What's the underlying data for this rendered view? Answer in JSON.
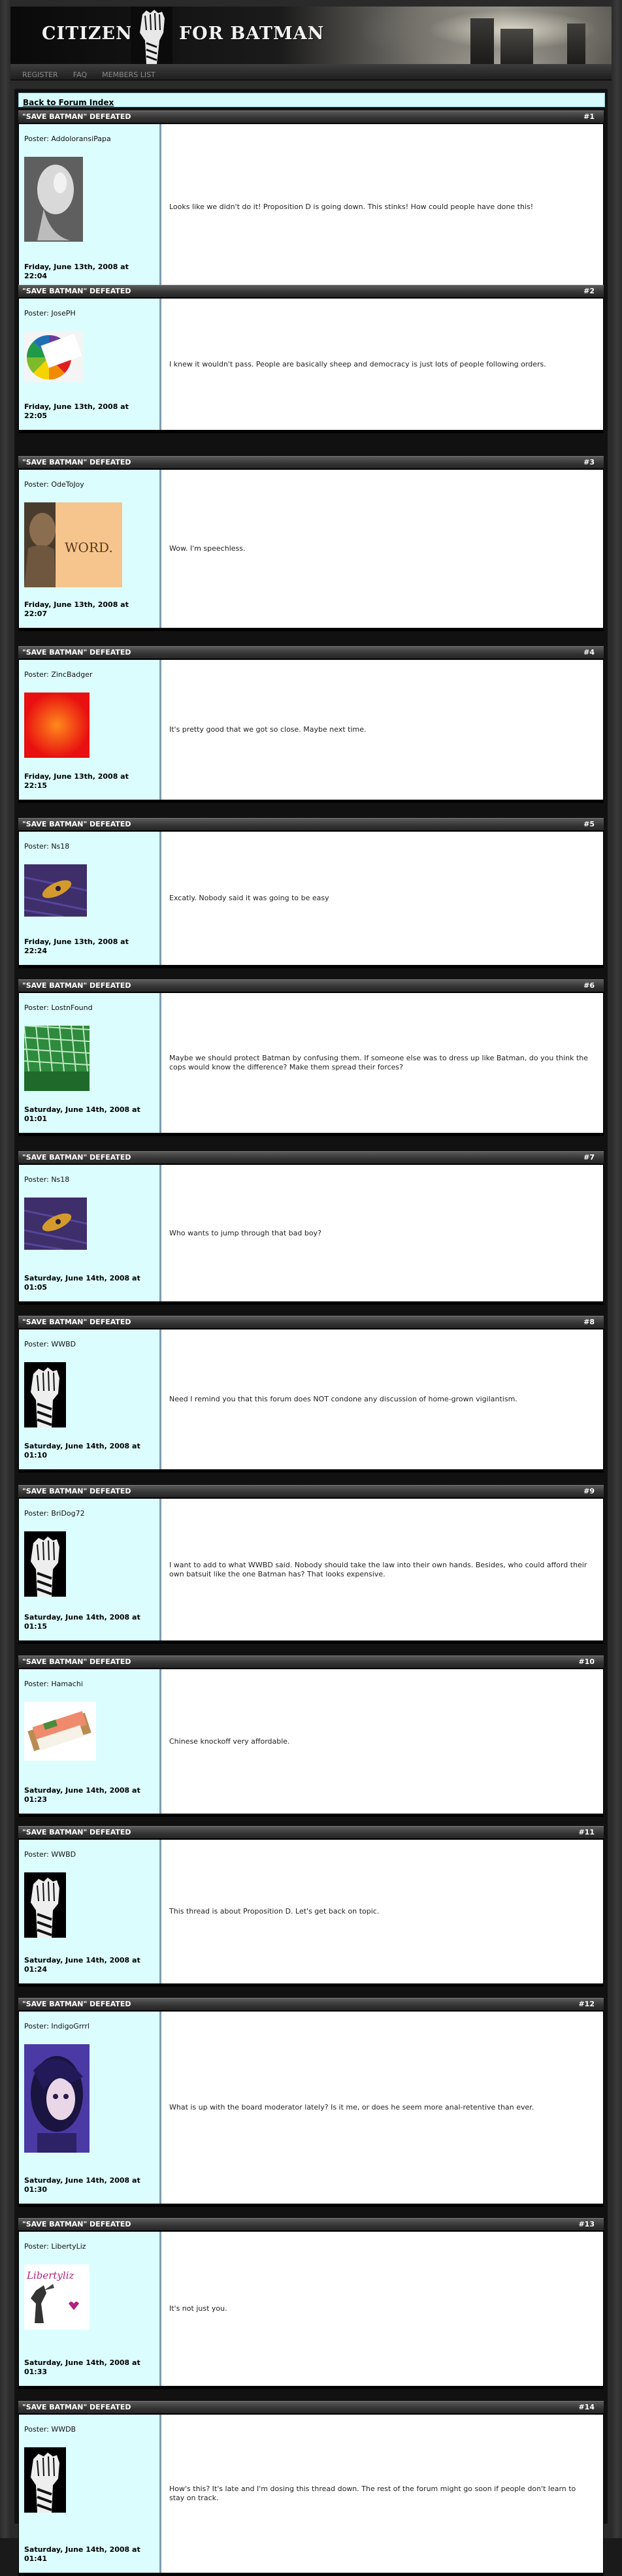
{
  "site": {
    "title_left": "CITIZENS",
    "title_right": "FOR BATMAN"
  },
  "nav": {
    "items": [
      "REGISTER",
      "FAQ",
      "MEMBERS LIST"
    ]
  },
  "back_link": "Back to Forum Index",
  "thread_title": "\"SAVE BATMAN\" DEFEATED",
  "poster_prefix": "Poster:",
  "posts": [
    {
      "num": "#1",
      "poster": "AddoloransiPapa",
      "date": "Friday, June 13th, 2008 at 22:04",
      "avatar": "hand-photo",
      "text": "Looks like we didn't do it! Proposition D is going down. This stinks! How could people have done this!"
    },
    {
      "num": "#2",
      "poster": "JosePH",
      "date": "Friday, June 13th, 2008 at 22:05",
      "avatar": "color-wheel",
      "text": "I knew it wouldn't pass. People are basically sheep and democracy is just lots of people following orders."
    },
    {
      "num": "#3",
      "poster": "OdeToJoy",
      "date": "Friday, June 13th, 2008 at 22:07",
      "avatar": "word-bust",
      "avatar_text": "WORD.",
      "text": "Wow. I'm speechless."
    },
    {
      "num": "#4",
      "poster": "ZincBadger",
      "date": "Friday, June 13th, 2008 at 22:15",
      "avatar": "red-orange",
      "text": "It's pretty good that we got so close. Maybe next time."
    },
    {
      "num": "#5",
      "poster": "Ns18",
      "date": "Friday, June 13th, 2008 at 22:24",
      "avatar": "purple-slug",
      "text": "Excatly. Nobody said it was going to be easy"
    },
    {
      "num": "#6",
      "poster": "LostnFound",
      "date": "Saturday, June 14th, 2008 at 01:01",
      "avatar": "green-building",
      "text": "Maybe we should protect Batman by confusing them. If someone else was to dress up like Batman, do you think the cops would know the difference? Make them spread their forces?"
    },
    {
      "num": "#7",
      "poster": "Ns18",
      "date": "Saturday, June 14th, 2008 at 01:05",
      "avatar": "purple-slug",
      "text": "Who wants to jump through that bad boy?"
    },
    {
      "num": "#8",
      "poster": "WWBD",
      "date": "Saturday, June 14th, 2008 at 01:10",
      "avatar": "fist",
      "text": "Need I remind you that this forum does NOT condone any discussion of home-grown vigilantism."
    },
    {
      "num": "#9",
      "poster": "BriDog72",
      "date": "Saturday, June 14th, 2008 at 01:15",
      "avatar": "fist",
      "text": "I want to add to what WWBD said. Nobody should take the law into their own hands. Besides, who could afford their own batsuit like the one Batman has? That looks expensive."
    },
    {
      "num": "#10",
      "poster": "Hamachi",
      "date": "Saturday, June 14th, 2008 at 01:23",
      "avatar": "sushi",
      "text": "Chinese knockoff very affordable."
    },
    {
      "num": "#11",
      "poster": "WWBD",
      "date": "Saturday, June 14th, 2008 at 01:24",
      "avatar": "fist",
      "text": "This thread is about Proposition D. Let's get back on topic."
    },
    {
      "num": "#12",
      "poster": "IndigoGrrrl",
      "date": "Saturday, June 14th, 2008 at 01:30",
      "avatar": "indigo-girl",
      "text": "What is up with the board moderator lately? Is it me, or does he seem more anal-retentive than ever."
    },
    {
      "num": "#13",
      "poster": "LibertyLiz",
      "date": "Saturday, June 14th, 2008 at 01:33",
      "avatar": "liberty",
      "avatar_text": "Libertyliz",
      "text": "It's not just you."
    },
    {
      "num": "#14",
      "poster": "WWDB",
      "date": "Saturday, June 14th, 2008 at 01:41",
      "avatar": "fist",
      "text": "How's this? It's late and I'm dosing this thread down. The rest of the forum might go soon if people don't learn to stay on track."
    }
  ],
  "colors": {
    "sidebar_bg": "#dcfdfe",
    "header_bg": "#333333",
    "body_bg": "#ffffff"
  }
}
